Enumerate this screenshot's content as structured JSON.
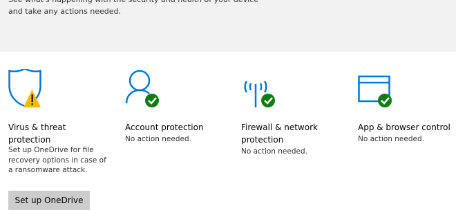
{
  "header": {
    "subtitle_line1": "See what's happening with the security and health of your device",
    "subtitle_line2": "and take any actions needed."
  },
  "tiles": [
    {
      "title_line1": "Virus & threat",
      "title_line2": "protection",
      "desc_line1": "Set up OneDrive for file",
      "desc_line2": "recovery options in case of",
      "desc_line3": "a ransomware attack.",
      "icon": "shield-warning-icon",
      "status": "warning",
      "button_label": "Set up OneDrive"
    },
    {
      "title_line1": "Account protection",
      "desc_line1": "No action needed.",
      "icon": "person-check-icon",
      "status": "ok"
    },
    {
      "title_line1": "Firewall & network",
      "title_line2": "protection",
      "desc_line1": "No action needed.",
      "icon": "antenna-check-icon",
      "status": "ok"
    },
    {
      "title_line1": "App & browser control",
      "desc_line1": "No action needed.",
      "icon": "browser-window-check-icon",
      "status": "ok"
    }
  ],
  "colors": {
    "accent": "#0078d7",
    "ok": "#107c10",
    "warning": "#ffb900",
    "header_bg": "#f2f2f2",
    "button_bg": "#cccccc"
  }
}
